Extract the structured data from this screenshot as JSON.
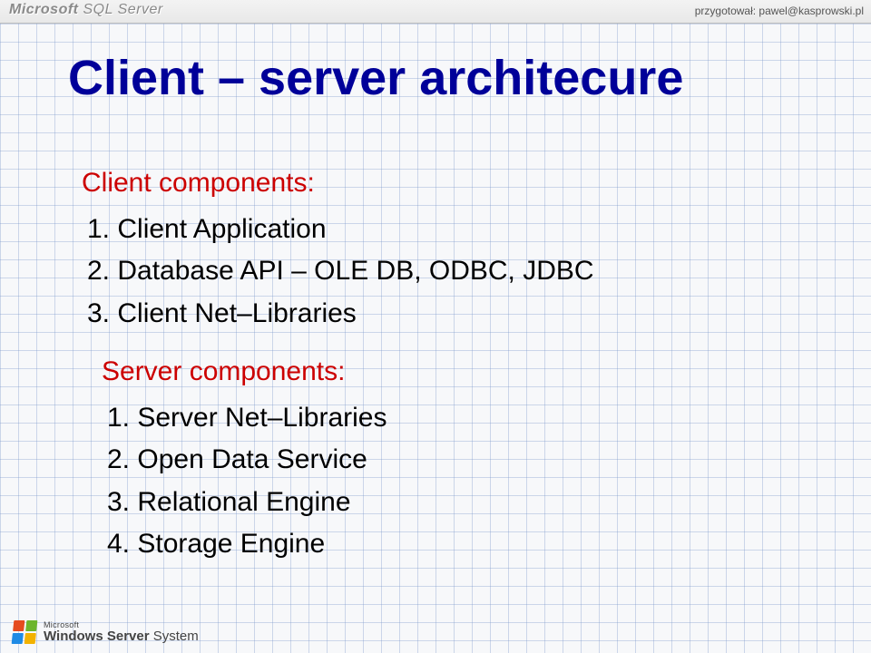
{
  "header": {
    "brand_main": "Microsoft",
    "brand_rest": " SQL Server",
    "prepared_by": "przygotował: pawel@kasprowski.pl"
  },
  "title": "Client – server architecure",
  "client_section": {
    "heading": "Client components:",
    "items": [
      "Client Application",
      "Database API – OLE DΒ, ODBC, JDBC",
      "Client Net–Libraries"
    ]
  },
  "server_section": {
    "heading": "Server components:",
    "items": [
      "Server Net–Libraries",
      "Open Data Service",
      "Relational Engine",
      "Storage Engine"
    ]
  },
  "footer": {
    "company": "Microsoft",
    "product_strong": "Windows Server",
    "product_light": " System"
  }
}
